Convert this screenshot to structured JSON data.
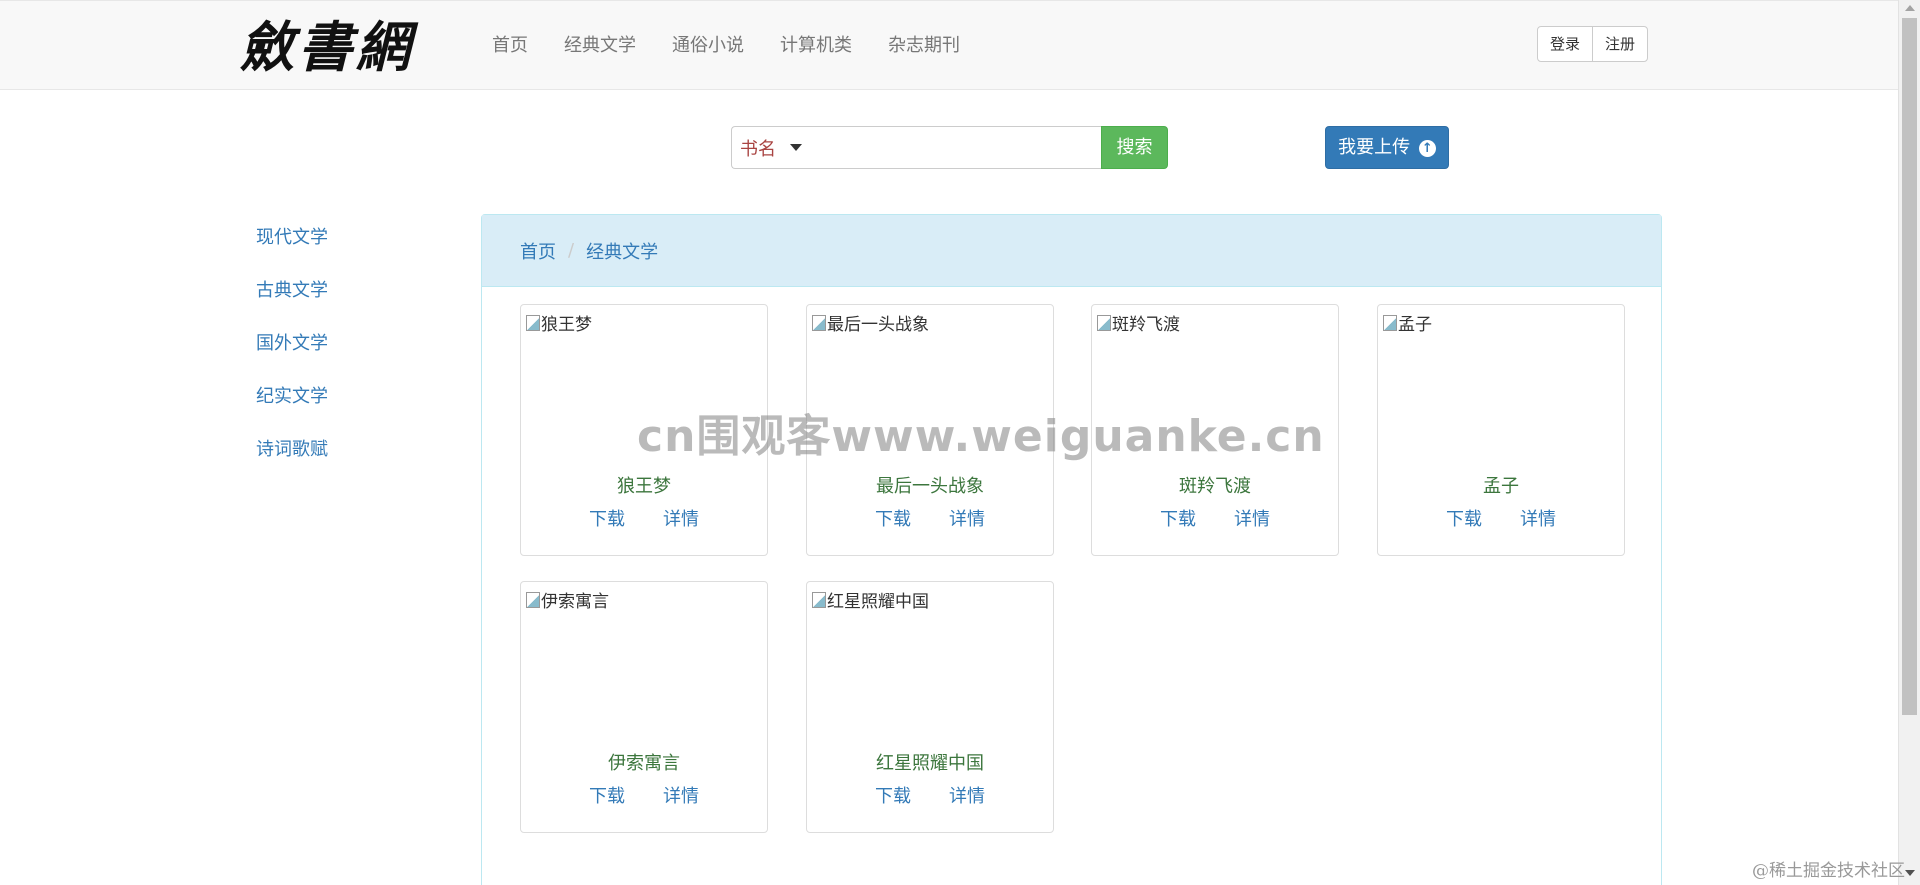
{
  "header": {
    "logo_text": "斂書網",
    "nav": [
      "首页",
      "经典文学",
      "通俗小说",
      "计算机类",
      "杂志期刊"
    ],
    "login_label": "登录",
    "register_label": "注册"
  },
  "search": {
    "select_value": "书名",
    "button_label": "搜索",
    "input_value": ""
  },
  "upload": {
    "label": "我要上传",
    "icon": "arrow-up-circle-icon"
  },
  "sidebar": {
    "items": [
      "现代文学",
      "古典文学",
      "国外文学",
      "纪实文学",
      "诗词歌赋"
    ]
  },
  "breadcrumb": {
    "items": [
      "首页",
      "经典文学"
    ],
    "separator": "/"
  },
  "books": [
    {
      "img_alt": "狼王梦",
      "title": "狼王梦",
      "download": "下载",
      "detail": "详情"
    },
    {
      "img_alt": "最后一头战象",
      "title": "最后一头战象",
      "download": "下载",
      "detail": "详情"
    },
    {
      "img_alt": "斑羚飞渡",
      "title": "斑羚飞渡",
      "download": "下载",
      "detail": "详情"
    },
    {
      "img_alt": "孟子",
      "title": "孟子",
      "download": "下载",
      "detail": "详情"
    },
    {
      "img_alt": "伊索寓言",
      "title": "伊索寓言",
      "download": "下载",
      "detail": "详情"
    },
    {
      "img_alt": "红星照耀中国",
      "title": "红星照耀中国",
      "download": "下载",
      "detail": "详情"
    }
  ],
  "watermark": "cn围观客www.weiguanke.cn",
  "credit": "@稀土掘金技术社区",
  "colors": {
    "link": "#337ab7",
    "search_button": "#5cb85c",
    "upload_button": "#337ab7",
    "breadcrumb_bg": "#d9edf7",
    "book_title": "#3c763d",
    "select_text": "#a94442"
  }
}
